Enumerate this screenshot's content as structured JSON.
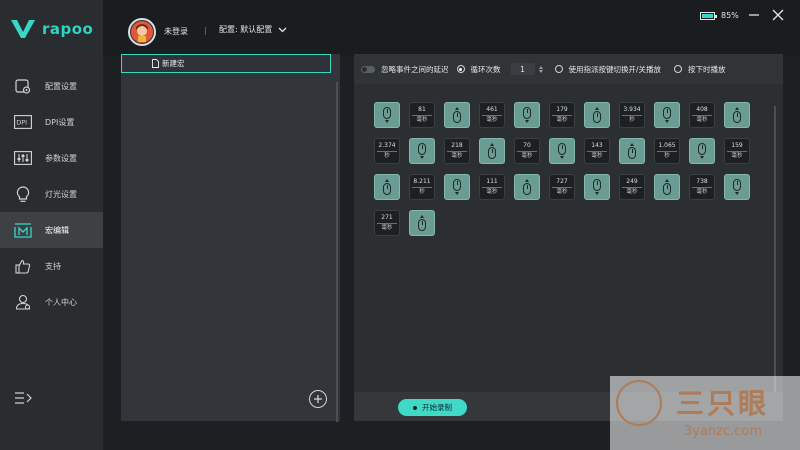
{
  "brand": {
    "logo_text": "rapoo"
  },
  "sidebar": {
    "items": [
      {
        "label": "配置设置",
        "icon": "config-icon"
      },
      {
        "label": "DPI设置",
        "icon": "dpi-icon"
      },
      {
        "label": "参数设置",
        "icon": "sliders-icon"
      },
      {
        "label": "灯光设置",
        "icon": "bulb-icon"
      },
      {
        "label": "宏编辑",
        "icon": "macro-icon",
        "active": true
      },
      {
        "label": "支持",
        "icon": "thumbs-up-icon"
      },
      {
        "label": "个人中心",
        "icon": "user-icon"
      }
    ],
    "accent": "#38d7c6"
  },
  "header": {
    "login": "未登录",
    "separator": "|",
    "profile": "配置: 默认配置",
    "battery": "85%",
    "battery_level": 0.85
  },
  "macro_list": {
    "items": [
      "新建宏"
    ]
  },
  "options": {
    "ignore_delay": "忽略事件之间的延迟",
    "loop_count_label": "循环次数",
    "loop_count_value": "1",
    "toggle_mode": "使用指派按键切换开/关播放",
    "hold_mode": "按下时播放"
  },
  "events": [
    {
      "t": "mouse",
      "dir": "down"
    },
    {
      "t": "delay",
      "v": "81",
      "u": "毫秒"
    },
    {
      "t": "mouse",
      "dir": "up"
    },
    {
      "t": "delay",
      "v": "461",
      "u": "毫秒"
    },
    {
      "t": "mouse",
      "dir": "down"
    },
    {
      "t": "delay",
      "v": "179",
      "u": "毫秒"
    },
    {
      "t": "mouse",
      "dir": "up"
    },
    {
      "t": "delay",
      "v": "3.934",
      "u": "秒"
    },
    {
      "t": "mouse",
      "dir": "down"
    },
    {
      "t": "delay",
      "v": "408",
      "u": "毫秒"
    },
    {
      "t": "mouse",
      "dir": "up"
    },
    {
      "t": "delay",
      "v": "2.374",
      "u": "秒"
    },
    {
      "t": "mouse",
      "dir": "down"
    },
    {
      "t": "delay",
      "v": "218",
      "u": "毫秒"
    },
    {
      "t": "mouse",
      "dir": "up"
    },
    {
      "t": "delay",
      "v": "70",
      "u": "毫秒"
    },
    {
      "t": "mouse",
      "dir": "down"
    },
    {
      "t": "delay",
      "v": "143",
      "u": "毫秒"
    },
    {
      "t": "mouse",
      "dir": "up"
    },
    {
      "t": "delay",
      "v": "1.065",
      "u": "秒"
    },
    {
      "t": "mouse",
      "dir": "down"
    },
    {
      "t": "delay",
      "v": "159",
      "u": "毫秒"
    },
    {
      "t": "mouse",
      "dir": "up"
    },
    {
      "t": "delay",
      "v": "8.211",
      "u": "秒"
    },
    {
      "t": "mouse",
      "dir": "down"
    },
    {
      "t": "delay",
      "v": "111",
      "u": "毫秒"
    },
    {
      "t": "mouse",
      "dir": "up"
    },
    {
      "t": "delay",
      "v": "727",
      "u": "毫秒"
    },
    {
      "t": "mouse",
      "dir": "down"
    },
    {
      "t": "delay",
      "v": "249",
      "u": "毫秒"
    },
    {
      "t": "mouse",
      "dir": "up"
    },
    {
      "t": "delay",
      "v": "738",
      "u": "毫秒"
    },
    {
      "t": "mouse",
      "dir": "down"
    },
    {
      "t": "delay",
      "v": "271",
      "u": "毫秒"
    },
    {
      "t": "mouse",
      "dir": "up"
    }
  ],
  "footer": {
    "record": "开始录制"
  },
  "watermark": {
    "cn": "三只眼",
    "url": "3yanzc.com"
  }
}
